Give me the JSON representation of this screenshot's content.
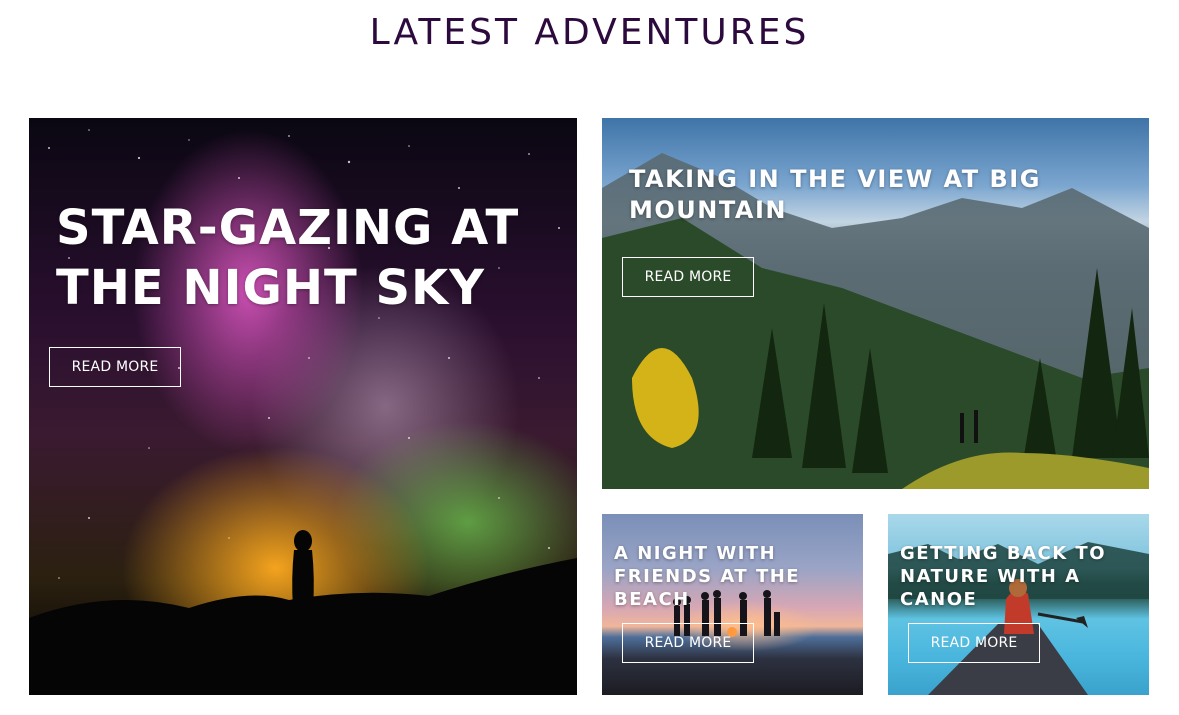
{
  "section": {
    "title": "LATEST ADVENTURES"
  },
  "cards": [
    {
      "title": "STAR-GAZING AT THE NIGHT SKY",
      "button_label": "READ MORE",
      "image": "night-sky-silhouette-photo"
    },
    {
      "title": "TAKING IN THE VIEW AT BIG MOUNTAIN",
      "button_label": "READ MORE",
      "image": "mountain-valley-photo"
    },
    {
      "title": "A NIGHT WITH FRIENDS AT THE BEACH",
      "button_label": "READ MORE",
      "image": "beach-sunset-friends-photo"
    },
    {
      "title": "GETTING BACK TO NATURE WITH A CANOE",
      "button_label": "READ MORE",
      "image": "canoe-lake-photo"
    }
  ],
  "colors": {
    "title": "#2d0a3d",
    "card_text": "#ffffff",
    "background": "#ffffff"
  }
}
